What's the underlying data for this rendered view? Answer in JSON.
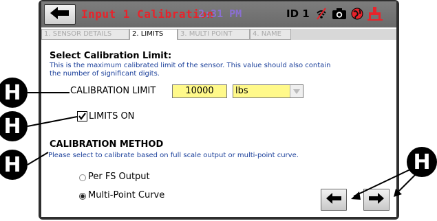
{
  "header": {
    "title": "Input 1 Calibration",
    "time": "2:31 PM",
    "device_id": "ID 1",
    "icons": [
      "back-arrow-icon",
      "no-wifi-icon",
      "camera-icon",
      "globe-icon",
      "usb-icon"
    ]
  },
  "tabs": [
    {
      "label": "1. SENSOR DETAILS",
      "active": false
    },
    {
      "label": "2. LIMITS",
      "active": true
    },
    {
      "label": "3. MULTI POINT",
      "active": false
    },
    {
      "label": "4. NAME",
      "active": false
    }
  ],
  "limit_section": {
    "title": "Select Calibration Limit:",
    "description_line1": "This is the maximum calibrated limit of the sensor.  This value should also contain",
    "description_line2": "the number of significant digits.",
    "limit_label": "CALIBRATION LIMIT",
    "limit_value": "10000",
    "unit_value": "lbs"
  },
  "limits_on": {
    "label": "LIMITS ON",
    "checked": true
  },
  "method_section": {
    "title": "CALIBRATION METHOD",
    "description": "Please select to calibrate based on full scale output or multi-point curve.",
    "options": [
      {
        "label": "Per FS Output",
        "selected": false
      },
      {
        "label": "Multi-Point Curve",
        "selected": true
      }
    ]
  },
  "callouts": {
    "letter": "H"
  },
  "colors": {
    "title_red": "#e8232b",
    "time_purple": "#8a6fd1",
    "description_blue": "#1a3f9a",
    "field_yellow": "#fff98a"
  }
}
